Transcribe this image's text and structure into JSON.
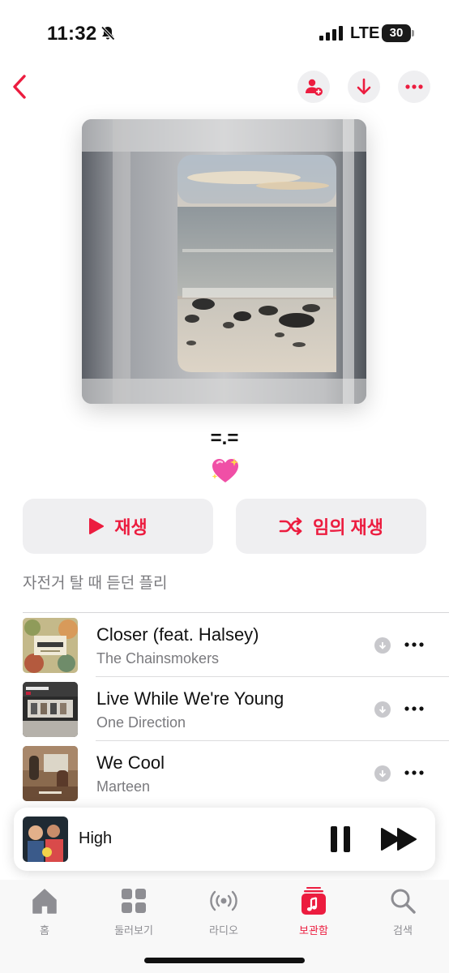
{
  "status_bar": {
    "time": "11:32",
    "network": "LTE",
    "battery": "30"
  },
  "icons": {
    "back": "chevron-left-icon",
    "collaborate": "person-add-icon",
    "download": "arrow-down-icon",
    "more": "ellipsis-icon",
    "play": "play-icon",
    "shuffle": "shuffle-icon",
    "pause": "pause-icon",
    "forward": "forward-icon"
  },
  "colors": {
    "accent": "#ec1c3f",
    "secondary_text": "#7a7a7e",
    "button_bg": "#efeff1"
  },
  "playlist": {
    "title": "=.=",
    "emoji": "sparkling-heart",
    "description": "자전거 탈 때 듣던 플리",
    "play_label": "재생",
    "shuffle_label": "임의 재생"
  },
  "tracks": [
    {
      "title": "Closer (feat. Halsey)",
      "artist": "The Chainsmokers"
    },
    {
      "title": "Live While We're Young",
      "artist": "One Direction"
    },
    {
      "title": "We Cool",
      "artist": "Marteen"
    }
  ],
  "now_playing": {
    "title": "High"
  },
  "tabs": [
    {
      "label": "홈",
      "icon": "home-icon",
      "active": false
    },
    {
      "label": "둘러보기",
      "icon": "grid-icon",
      "active": false
    },
    {
      "label": "라디오",
      "icon": "radio-icon",
      "active": false
    },
    {
      "label": "보관함",
      "icon": "library-icon",
      "active": true
    },
    {
      "label": "검색",
      "icon": "search-icon",
      "active": false
    }
  ]
}
